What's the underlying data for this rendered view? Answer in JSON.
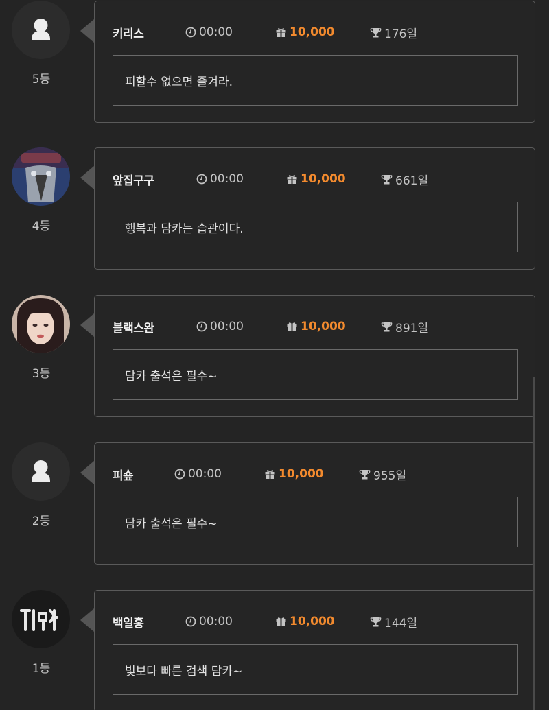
{
  "entries": [
    {
      "rank": "5등",
      "name": "키리스",
      "time": "00:00",
      "gift": "10,000",
      "days": "176일",
      "message": "피할수 없으면 즐겨라.",
      "avatar": "default-user"
    },
    {
      "rank": "4등",
      "name": "앞집구구",
      "time": "00:00",
      "gift": "10,000",
      "days": "661일",
      "message": "행복과 담카는 습관이다.",
      "avatar": "bird-photo"
    },
    {
      "rank": "3등",
      "name": "블랙스완",
      "time": "00:00",
      "gift": "10,000",
      "days": "891일",
      "message": "담카 출석은 필수~",
      "avatar": "portrait-photo"
    },
    {
      "rank": "2등",
      "name": "피숖",
      "time": "00:00",
      "gift": "10,000",
      "days": "955일",
      "message": "담카 출석은 필수~",
      "avatar": "default-user"
    },
    {
      "rank": "1등",
      "name": "백일홍",
      "time": "00:00",
      "gift": "10,000",
      "days": "144일",
      "message": "빛보다 빠른 검색 담카~",
      "avatar": "neon-sign-photo"
    }
  ],
  "icons": {
    "time": "clock-icon",
    "gift": "gift-icon",
    "days": "trophy-icon"
  },
  "colors": {
    "background": "#242424",
    "accent": "#f28a2e",
    "border": "#5a5a5a"
  }
}
